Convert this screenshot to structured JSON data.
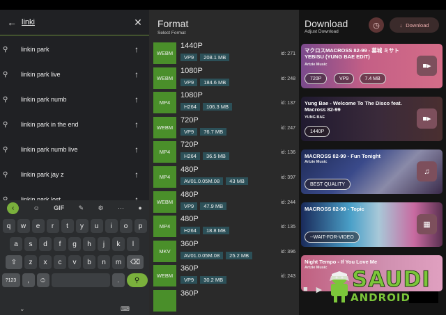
{
  "search": {
    "query": "linki"
  },
  "suggestions": [
    "linkin park",
    "linkin park live",
    "linkin park numb",
    "linkin park in the end",
    "linkin park numb live",
    "linkin park jay z",
    "linkin park lost"
  ],
  "keyboard": {
    "tools": [
      "GIF"
    ],
    "row1": [
      "q",
      "w",
      "e",
      "r",
      "t",
      "y",
      "u",
      "i",
      "o",
      "p"
    ],
    "row1_sup": [
      "1",
      "2",
      "3",
      "4",
      "5",
      "6",
      "7",
      "8",
      "9",
      "0"
    ],
    "row2": [
      "a",
      "s",
      "d",
      "f",
      "g",
      "h",
      "j",
      "k",
      "l"
    ],
    "row3": [
      "z",
      "x",
      "c",
      "v",
      "b",
      "n",
      "m"
    ],
    "row4_sym": "?123",
    "row4_comma": ",",
    "row4_period": "."
  },
  "format_panel": {
    "title": "Format",
    "subtitle": "Select Format",
    "items": [
      {
        "container": "WEBM",
        "res": "1440P",
        "codec": "VP9",
        "size": "208.1 MB",
        "id": "id: 271"
      },
      {
        "container": "WEBM",
        "res": "1080P",
        "codec": "VP9",
        "size": "184.6 MB",
        "id": "id: 248"
      },
      {
        "container": "MP4",
        "res": "1080P",
        "codec": "H264",
        "size": "106.3 MB",
        "id": "id: 137"
      },
      {
        "container": "WEBM",
        "res": "720P",
        "codec": "VP9",
        "size": "76.7 MB",
        "id": "id: 247"
      },
      {
        "container": "MP4",
        "res": "720P",
        "codec": "H264",
        "size": "36.5 MB",
        "id": "id: 136"
      },
      {
        "container": "MP4",
        "res": "480P",
        "codec": "AV01.0.05M.08",
        "size": "43 MB",
        "id": "id: 397"
      },
      {
        "container": "WEBM",
        "res": "480P",
        "codec": "VP9",
        "size": "47.9 MB",
        "id": "id: 244"
      },
      {
        "container": "MP4",
        "res": "480P",
        "codec": "H264",
        "size": "18.8 MB",
        "id": "id: 135"
      },
      {
        "container": "MKV",
        "res": "360P",
        "codec": "AV01.0.05M.08",
        "size": "25.2 MB",
        "id": "id: 396"
      },
      {
        "container": "WEBM",
        "res": "360P",
        "codec": "VP9",
        "size": "30.2 MB",
        "id": "id: 243"
      },
      {
        "container": "",
        "res": "360P",
        "codec": "",
        "size": "",
        "id": ""
      }
    ]
  },
  "download_panel": {
    "title": "Download",
    "subtitle": "Adjust Download",
    "download_label": "Download",
    "cards": [
      {
        "title": "マクロスMACROSS 82-99 - 墓城 ミサト YEBISU (YUNG BAE EDIT)",
        "artist": "Artzie Music",
        "chips": [
          "720P",
          "VP9",
          "7.4 MB"
        ],
        "icon": "video-icon"
      },
      {
        "title": "Yung Bae - Welcome To The Disco feat. Macross 82-99",
        "artist": "YUNG BAE",
        "chips": [
          "1440P"
        ],
        "icon": "video-icon"
      },
      {
        "title": "MACROSS 82-99 - Fun Tonight",
        "artist": "Artzie Music",
        "chips": [
          "BEST QUALITY"
        ],
        "icon": "music-icon"
      },
      {
        "title": "MACROSS 82-99 - Topic",
        "artist": "",
        "chips": [
          "--WAIT-FOR-VIDEO"
        ],
        "icon": "command-icon"
      },
      {
        "title": "Night Tempo - If You Love Me",
        "artist": "Artzie Music",
        "chips": [],
        "icon": ""
      }
    ]
  },
  "watermark": {
    "line1": "SAUDI",
    "line2": "ANDROID"
  },
  "colors": {
    "format_badge": "#4a8f2a",
    "format_tag": "#2c5058",
    "accent_green": "#7ab03c",
    "download_accent": "#f0b0b0"
  }
}
